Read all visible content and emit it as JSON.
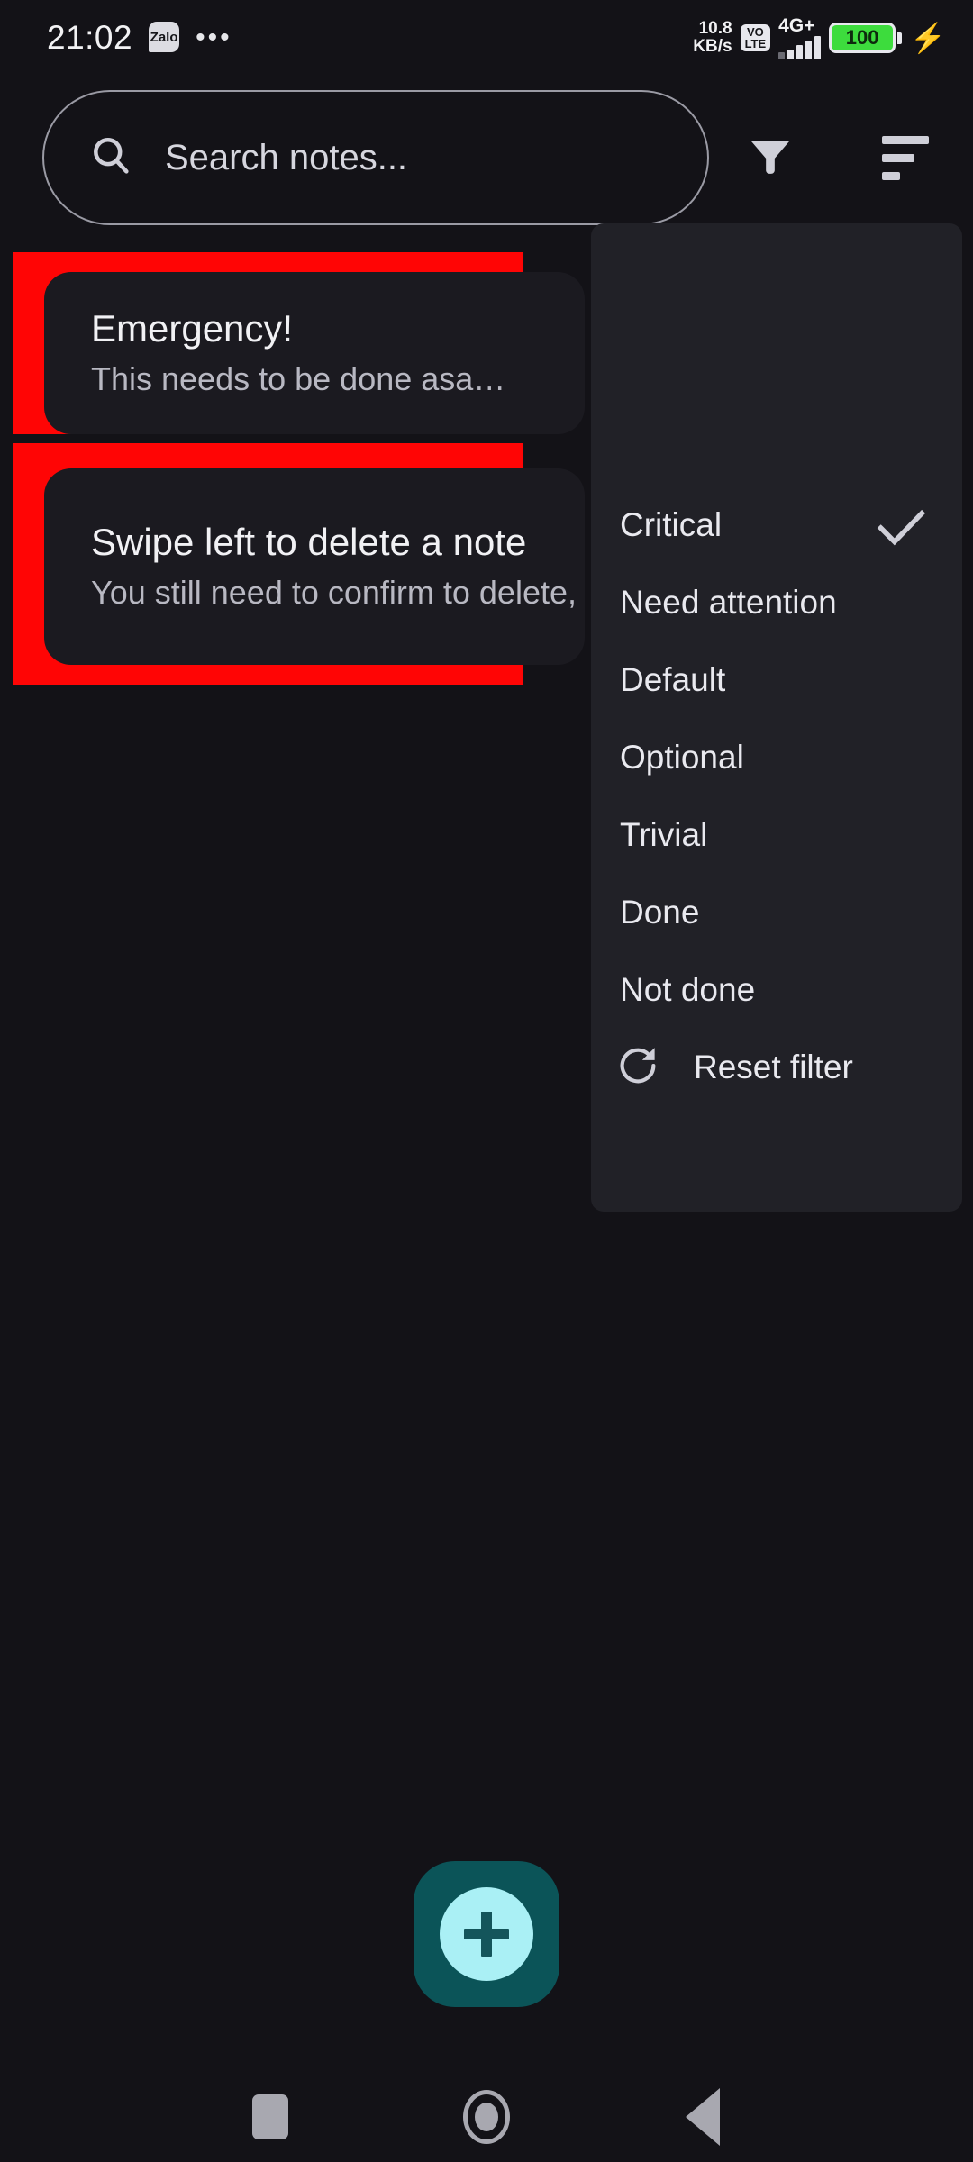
{
  "status_bar": {
    "time": "21:02",
    "app_badge": "Zalo",
    "overflow": "•••",
    "network_speed_value": "10.8",
    "network_speed_unit": "KB/s",
    "volte_top": "VO",
    "volte_bottom": "LTE",
    "network_type": "4G+",
    "battery_level": "100",
    "battery_color": "#3ddc3d",
    "charging_icon": "⚡",
    "signal_icon": "signal-bars-icon"
  },
  "search": {
    "placeholder": "Search notes...",
    "value": "",
    "icon": "search-icon"
  },
  "toolbar": {
    "filter_icon": "filter-funnel-icon",
    "sort_icon": "sort-icon"
  },
  "notes": [
    {
      "title": "Emergency!",
      "subtitle": "This needs to be done asa…",
      "swipe_color": "#ff0505"
    },
    {
      "title": "Swipe left to delete a note",
      "subtitle": "You still need to confirm to delete,",
      "swipe_color": "#ff0505"
    }
  ],
  "filter_menu": {
    "items": [
      {
        "label": "Critical",
        "checked": true
      },
      {
        "label": "Need attention",
        "checked": false
      },
      {
        "label": "Default",
        "checked": false
      },
      {
        "label": "Optional",
        "checked": false
      },
      {
        "label": "Trivial",
        "checked": false
      },
      {
        "label": "Done",
        "checked": false
      },
      {
        "label": "Not done",
        "checked": false
      }
    ],
    "reset": {
      "label": "Reset filter",
      "icon": "refresh-icon"
    },
    "check_icon": "check-icon",
    "background": "#212127"
  },
  "fab": {
    "icon": "plus-icon",
    "background": "#0b5458",
    "circle_color": "#aaf0f5"
  },
  "navbar": {
    "recents": "recents-square-icon",
    "home": "home-circle-icon",
    "back": "back-triangle-icon"
  }
}
